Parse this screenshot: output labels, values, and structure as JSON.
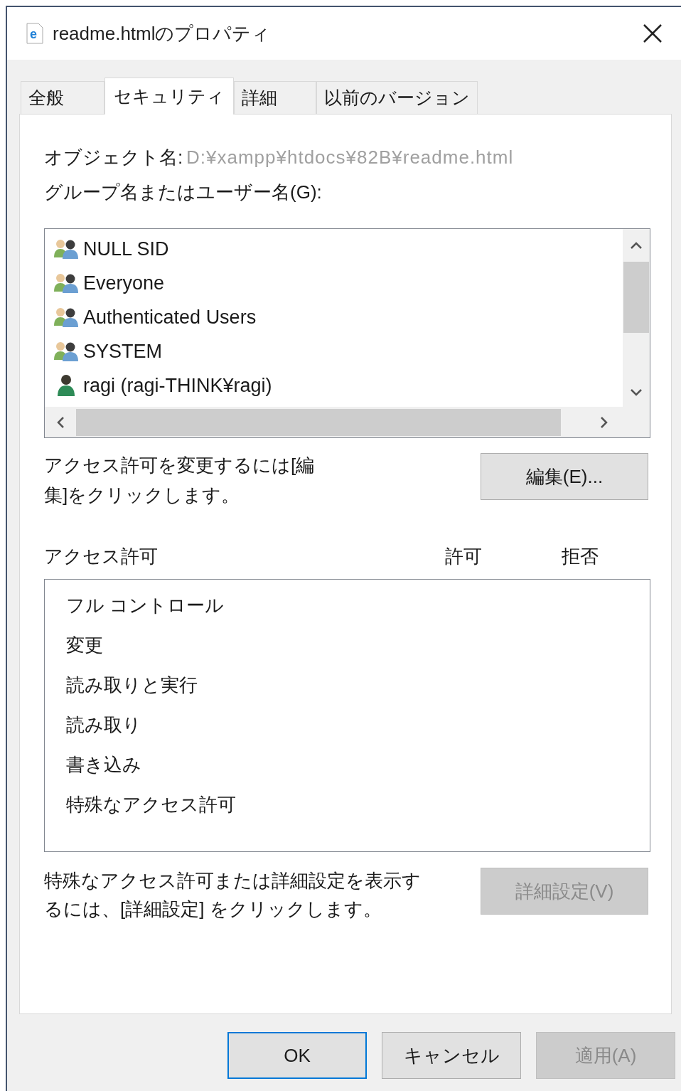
{
  "window": {
    "title": "readme.htmlのプロパティ",
    "icon_glyph": "e"
  },
  "tabs": [
    {
      "label": "全般",
      "selected": false
    },
    {
      "label": "セキュリティ",
      "selected": true
    },
    {
      "label": "詳細",
      "selected": false
    },
    {
      "label": "以前のバージョン",
      "selected": false
    }
  ],
  "object_name": {
    "label": "オブジェクト名:",
    "value": "D:¥xampp¥htdocs¥82B¥readme.html"
  },
  "principals_label": "グループ名またはユーザー名(G):",
  "principals": [
    {
      "name": "NULL SID",
      "kind": "group"
    },
    {
      "name": "Everyone",
      "kind": "group"
    },
    {
      "name": "Authenticated Users",
      "kind": "group"
    },
    {
      "name": "SYSTEM",
      "kind": "group"
    },
    {
      "name": "ragi (ragi-THINK¥ragi)",
      "kind": "user"
    }
  ],
  "edit_hint": "アクセス許可を変更するには[編集]をクリックします。",
  "edit_button": {
    "label": "編集(E)..."
  },
  "permissions": {
    "label": "アクセス許可",
    "columns": [
      "許可",
      "拒否"
    ],
    "rows": [
      "フル コントロール",
      "変更",
      "読み取りと実行",
      "読み取り",
      "書き込み",
      "特殊なアクセス許可"
    ]
  },
  "advanced_hint": "特殊なアクセス許可または詳細設定を表示するには、[詳細設定] をクリックします。",
  "advanced_button": {
    "label": "詳細設定(V)",
    "disabled": true
  },
  "buttons": [
    {
      "label": "OK",
      "default": true,
      "disabled": false
    },
    {
      "label": "キャンセル",
      "default": false,
      "disabled": false
    },
    {
      "label": "適用(A)",
      "default": false,
      "disabled": true
    }
  ]
}
